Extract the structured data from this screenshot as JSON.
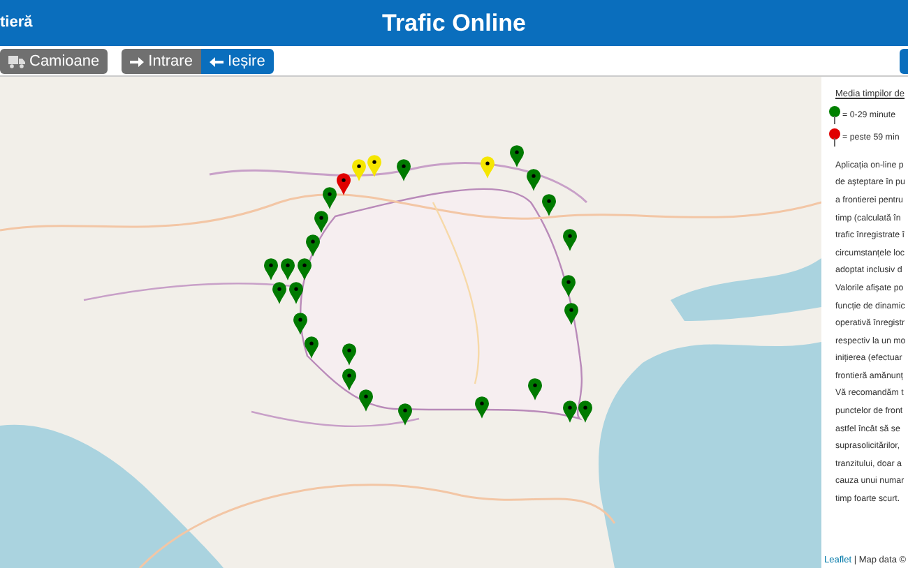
{
  "header": {
    "left_title": "tieră",
    "title": "Trafic Online"
  },
  "toolbar": {
    "vehicle_button": {
      "label": "Camioane"
    },
    "direction_tabs": [
      {
        "label": "Intrare",
        "selected": false,
        "kind": "entry"
      },
      {
        "label": "Ieșire",
        "selected": true,
        "kind": "exit"
      }
    ]
  },
  "map": {
    "kind": "picture",
    "markers": [
      {
        "color": "#e00000"
      },
      {
        "color": "#f5e600"
      },
      {
        "color": "#f5e600"
      },
      {
        "color": "#f5e600"
      },
      {
        "color": "#007a00"
      },
      {
        "color": "#007a00"
      },
      {
        "color": "#007a00"
      },
      {
        "color": "#007a00"
      },
      {
        "color": "#007a00"
      },
      {
        "color": "#007a00"
      },
      {
        "color": "#007a00"
      },
      {
        "color": "#007a00"
      },
      {
        "color": "#007a00"
      },
      {
        "color": "#007a00"
      },
      {
        "color": "#007a00"
      },
      {
        "color": "#007a00"
      },
      {
        "color": "#007a00"
      },
      {
        "color": "#007a00"
      },
      {
        "color": "#007a00"
      },
      {
        "color": "#007a00"
      },
      {
        "color": "#007a00"
      },
      {
        "color": "#007a00"
      },
      {
        "color": "#007a00"
      },
      {
        "color": "#007a00"
      },
      {
        "color": "#007a00"
      },
      {
        "color": "#007a00"
      },
      {
        "color": "#007a00"
      },
      {
        "color": "#007a00"
      },
      {
        "color": "#007a00"
      }
    ]
  },
  "legend": {
    "title": "Media timpilor de",
    "items": [
      {
        "color": "#008000",
        "label": "= 0-29 minute"
      },
      {
        "color": "#e00000",
        "label": "= peste 59 min"
      }
    ]
  },
  "description_lines": [
    "Aplicația on-line p",
    "de așteptare în pu",
    "a frontierei pentru",
    "timp (calculată în",
    "trafic înregistrate î",
    "circumstanțele loc",
    "adoptat inclusiv d",
    "Valorile afișate po",
    "funcție de dinamic",
    "operativă înregistr",
    "respectiv la un mo",
    "inițierea (efectuar",
    "frontieră amănunț",
    "Vă recomandăm t",
    "punctelor de front",
    "astfel încât să se",
    "suprasolicitărilor,",
    "tranzitului, doar a",
    "cauza unui numar",
    "timp foarte scurt."
  ],
  "attribution": {
    "link": "Leaflet",
    "text": "| Map data ©"
  }
}
